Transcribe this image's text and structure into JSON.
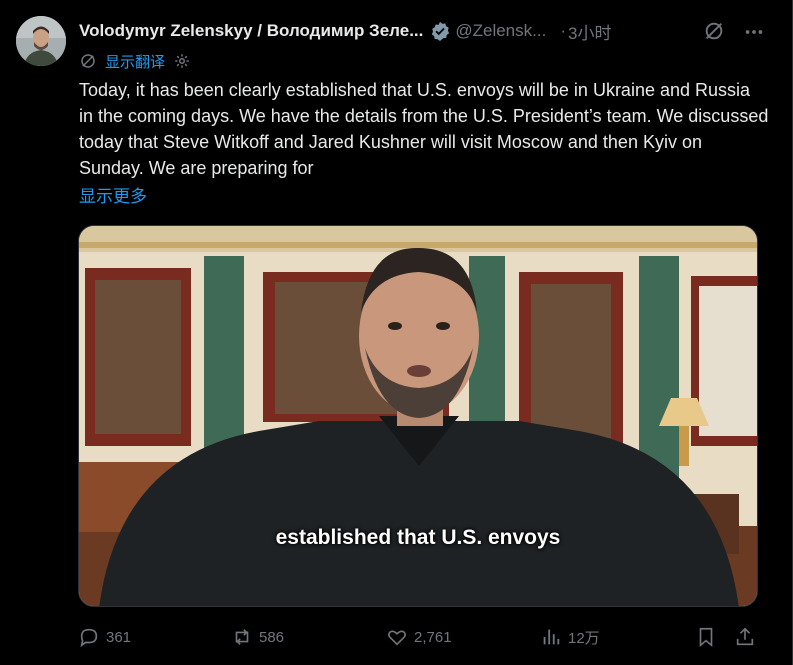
{
  "author": {
    "name": "Volodymyr Zelenskyy / Володимир Зеле...",
    "handle": "@Zelensk...",
    "time": "3小时"
  },
  "translate": {
    "label": "显示翻译"
  },
  "post": {
    "text": "Today, it has been clearly established that U.S. envoys will be in Ukraine and Russia in the coming days. We have the details from the U.S. President’s team. We discussed today that Steve Witkoff and Jared Kushner will visit Moscow and then Kyiv on Sunday. We are preparing for",
    "show_more": "显示更多"
  },
  "media": {
    "caption": "established that U.S. envoys"
  },
  "actions": {
    "replies": "361",
    "reposts": "586",
    "likes": "2,761",
    "views": "12万"
  },
  "colors": {
    "accent": "#1d9bf0",
    "muted": "#71767b",
    "text": "#e7e9ea",
    "background": "#000000"
  },
  "icons": [
    "verified-badge-icon",
    "grok-icon",
    "more-icon",
    "translate-icon",
    "settings-icon",
    "reply-icon",
    "repost-icon",
    "like-icon",
    "views-icon",
    "bookmark-icon",
    "share-icon"
  ]
}
